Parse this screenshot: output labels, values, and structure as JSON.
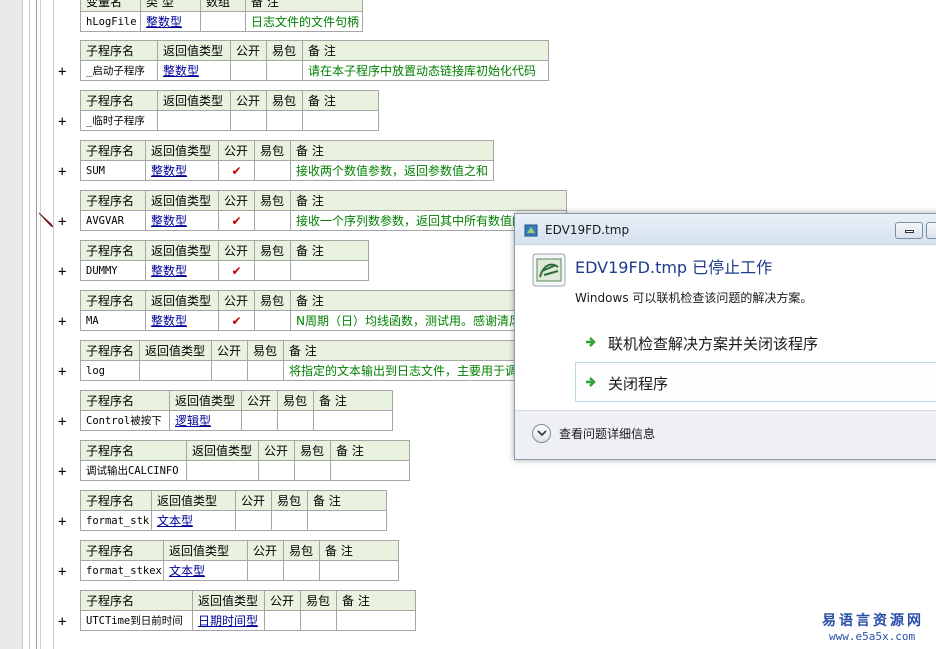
{
  "top_table": {
    "headers": [
      "变量名",
      "类 型",
      "数组",
      "备 注"
    ],
    "row": {
      "name": "hLogFile",
      "type": "整数型",
      "array": "",
      "note": "日志文件的文件句柄"
    }
  },
  "headers": {
    "name": "子程序名",
    "ret": "返回值类型",
    "public": "公开",
    "easy": "易包",
    "note": "备 注"
  },
  "subroutines": [
    {
      "name": "_启动子程序",
      "ret": "整数型",
      "public": "",
      "note": "请在本子程序中放置动态链接库初始化代码"
    },
    {
      "name": "_临时子程序",
      "ret": "",
      "public": "",
      "note": ""
    },
    {
      "name": "SUM",
      "ret": "整数型",
      "public": "✔",
      "note": "接收两个数值参数，返回参数值之和"
    },
    {
      "name": "AVGVAR",
      "ret": "整数型",
      "public": "✔",
      "note": "接收一个序列数参数，返回其中所有数值的"
    },
    {
      "name": "DUMMY",
      "ret": "整数型",
      "public": "✔",
      "note": ""
    },
    {
      "name": "MA",
      "ret": "整数型",
      "public": "✔",
      "note": "N周期（日）均线函数，测试用。感谢清风"
    },
    {
      "name": "log",
      "ret": "",
      "public": "",
      "note": "将指定的文本输出到日志文件，主要用于调"
    },
    {
      "name": "Control被按下",
      "ret": "逻辑型",
      "public": "",
      "note": ""
    },
    {
      "name": "调试输出CALCINFO",
      "ret": "",
      "public": "",
      "note": ""
    },
    {
      "name": "format_stk",
      "ret": "文本型",
      "public": "",
      "note": ""
    },
    {
      "name": "format_stkex",
      "ret": "文本型",
      "public": "",
      "note": ""
    },
    {
      "name": "UTCTime到日前时间",
      "ret": "日期时间型",
      "public": "",
      "note": ""
    }
  ],
  "expand_symbol": "+",
  "dialog": {
    "title": "EDV19FD.tmp",
    "heading": "EDV19FD.tmp 已停止工作",
    "subtext": "Windows 可以联机检查该问题的解决方案。",
    "option1": "联机检查解决方案并关闭该程序",
    "option2": "关闭程序",
    "details": "查看问题详细信息"
  },
  "watermark": {
    "line1": "易语言资源网",
    "line2": "www.e5a5x.com"
  },
  "colors": {
    "header_bg": "#e8f2de",
    "type_blue": "#000099",
    "note_green": "#008000",
    "check_red": "#c00000",
    "dialog_heading": "#1e3c8c",
    "arrow_green": "#2fa32f"
  }
}
